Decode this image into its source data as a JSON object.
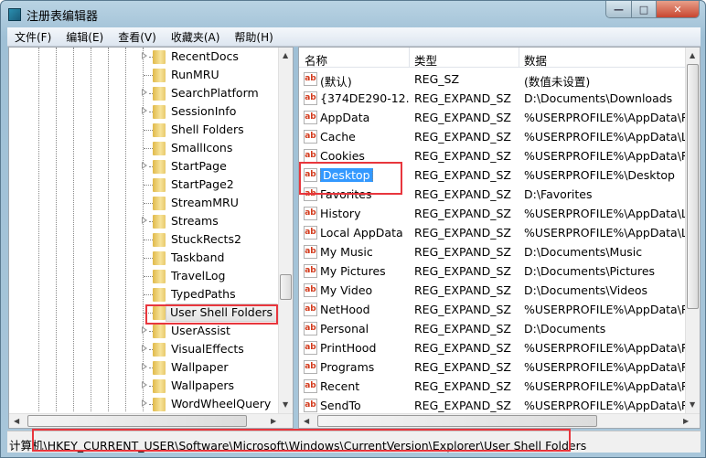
{
  "window": {
    "title": "注册表编辑器",
    "minimize": "—",
    "maximize": "□",
    "close": "✕"
  },
  "menu": [
    "文件(F)",
    "编辑(E)",
    "查看(V)",
    "收藏夹(A)",
    "帮助(H)"
  ],
  "tree": {
    "items": [
      {
        "label": "RecentDocs",
        "expandable": true
      },
      {
        "label": "RunMRU",
        "expandable": false
      },
      {
        "label": "SearchPlatform",
        "expandable": true
      },
      {
        "label": "SessionInfo",
        "expandable": true
      },
      {
        "label": "Shell Folders",
        "expandable": false
      },
      {
        "label": "SmallIcons",
        "expandable": false
      },
      {
        "label": "StartPage",
        "expandable": true
      },
      {
        "label": "StartPage2",
        "expandable": false
      },
      {
        "label": "StreamMRU",
        "expandable": false
      },
      {
        "label": "Streams",
        "expandable": true
      },
      {
        "label": "StuckRects2",
        "expandable": false
      },
      {
        "label": "Taskband",
        "expandable": false
      },
      {
        "label": "TravelLog",
        "expandable": false
      },
      {
        "label": "TypedPaths",
        "expandable": false
      },
      {
        "label": "User Shell Folders",
        "expandable": false,
        "selected": true
      },
      {
        "label": "UserAssist",
        "expandable": true
      },
      {
        "label": "VisualEffects",
        "expandable": true
      },
      {
        "label": "Wallpaper",
        "expandable": true
      },
      {
        "label": "Wallpapers",
        "expandable": true
      },
      {
        "label": "WordWheelQuery",
        "expandable": true
      }
    ]
  },
  "list": {
    "columns": [
      "名称",
      "类型",
      "数据"
    ],
    "rows": [
      {
        "name": "(默认)",
        "type": "REG_SZ",
        "data": "(数值未设置)"
      },
      {
        "name": "{374DE290-12...",
        "type": "REG_EXPAND_SZ",
        "data": "D:\\Documents\\Downloads"
      },
      {
        "name": "AppData",
        "type": "REG_EXPAND_SZ",
        "data": "%USERPROFILE%\\AppData\\Ro"
      },
      {
        "name": "Cache",
        "type": "REG_EXPAND_SZ",
        "data": "%USERPROFILE%\\AppData\\Lo"
      },
      {
        "name": "Cookies",
        "type": "REG_EXPAND_SZ",
        "data": "%USERPROFILE%\\AppData\\Ro"
      },
      {
        "name": "Desktop",
        "type": "REG_EXPAND_SZ",
        "data": "%USERPROFILE%\\Desktop",
        "selected": true
      },
      {
        "name": "Favorites",
        "type": "REG_EXPAND_SZ",
        "data": "D:\\Favorites"
      },
      {
        "name": "History",
        "type": "REG_EXPAND_SZ",
        "data": "%USERPROFILE%\\AppData\\Lo"
      },
      {
        "name": "Local AppData",
        "type": "REG_EXPAND_SZ",
        "data": "%USERPROFILE%\\AppData\\Lo"
      },
      {
        "name": "My Music",
        "type": "REG_EXPAND_SZ",
        "data": "D:\\Documents\\Music"
      },
      {
        "name": "My Pictures",
        "type": "REG_EXPAND_SZ",
        "data": "D:\\Documents\\Pictures"
      },
      {
        "name": "My Video",
        "type": "REG_EXPAND_SZ",
        "data": "D:\\Documents\\Videos"
      },
      {
        "name": "NetHood",
        "type": "REG_EXPAND_SZ",
        "data": "%USERPROFILE%\\AppData\\Ro"
      },
      {
        "name": "Personal",
        "type": "REG_EXPAND_SZ",
        "data": "D:\\Documents"
      },
      {
        "name": "PrintHood",
        "type": "REG_EXPAND_SZ",
        "data": "%USERPROFILE%\\AppData\\Ro"
      },
      {
        "name": "Programs",
        "type": "REG_EXPAND_SZ",
        "data": "%USERPROFILE%\\AppData\\Ro"
      },
      {
        "name": "Recent",
        "type": "REG_EXPAND_SZ",
        "data": "%USERPROFILE%\\AppData\\Ro"
      },
      {
        "name": "SendTo",
        "type": "REG_EXPAND_SZ",
        "data": "%USERPROFILE%\\AppData\\Ro"
      }
    ],
    "value_icon": "ab"
  },
  "status": {
    "path": "计算机\\HKEY_CURRENT_USER\\Software\\Microsoft\\Windows\\CurrentVersion\\Explorer\\User Shell Folders"
  },
  "colors": {
    "highlight_box": "#e8363d",
    "selection": "#3399ff"
  }
}
